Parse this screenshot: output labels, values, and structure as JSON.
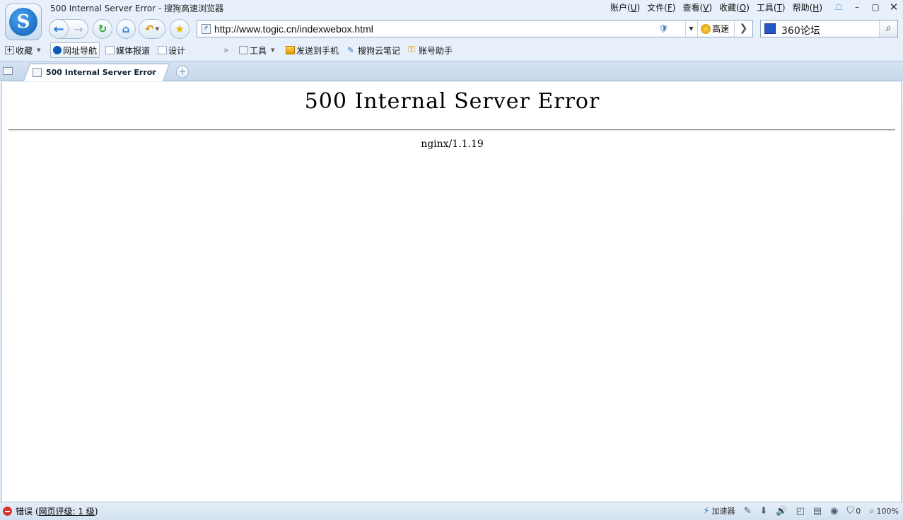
{
  "window": {
    "title": "500 Internal Server Error - 搜狗高速浏览器"
  },
  "menu": {
    "items": [
      {
        "label": "账户(",
        "key": "U",
        "suffix": ")"
      },
      {
        "label": "文件(",
        "key": "F",
        "suffix": ")"
      },
      {
        "label": "查看(",
        "key": "V",
        "suffix": ")"
      },
      {
        "label": "收藏(",
        "key": "O",
        "suffix": ")"
      },
      {
        "label": "工具(",
        "key": "T",
        "suffix": ")"
      },
      {
        "label": "帮助(",
        "key": "H",
        "suffix": ")"
      }
    ]
  },
  "address": {
    "url": "http://www.togic.cn/indexwebox.html",
    "speed_label": "高速"
  },
  "search": {
    "value": "360论坛"
  },
  "bookmarks": {
    "favorites": "收藏",
    "nav": "网址导航",
    "media": "媒体报道",
    "design": "设计",
    "tools": "工具",
    "send_phone": "发送到手机",
    "cloud_notes": "搜狗云笔记",
    "account_helper": "账号助手"
  },
  "tab": {
    "title": "500 Internal Server Error",
    "close": "×"
  },
  "page": {
    "heading": "500 Internal Server Error",
    "server": "nginx/1.1.19"
  },
  "status": {
    "error_label": "错误 (",
    "rating_link": "网页评级: 1 级",
    "rating_close": ")",
    "accelerator": "加速器",
    "blocked_count": "0",
    "zoom": "100%"
  },
  "colors": {
    "chrome_bg": "#dbe8f6",
    "accent": "#0b5cb5",
    "error_red": "#d9342b"
  }
}
